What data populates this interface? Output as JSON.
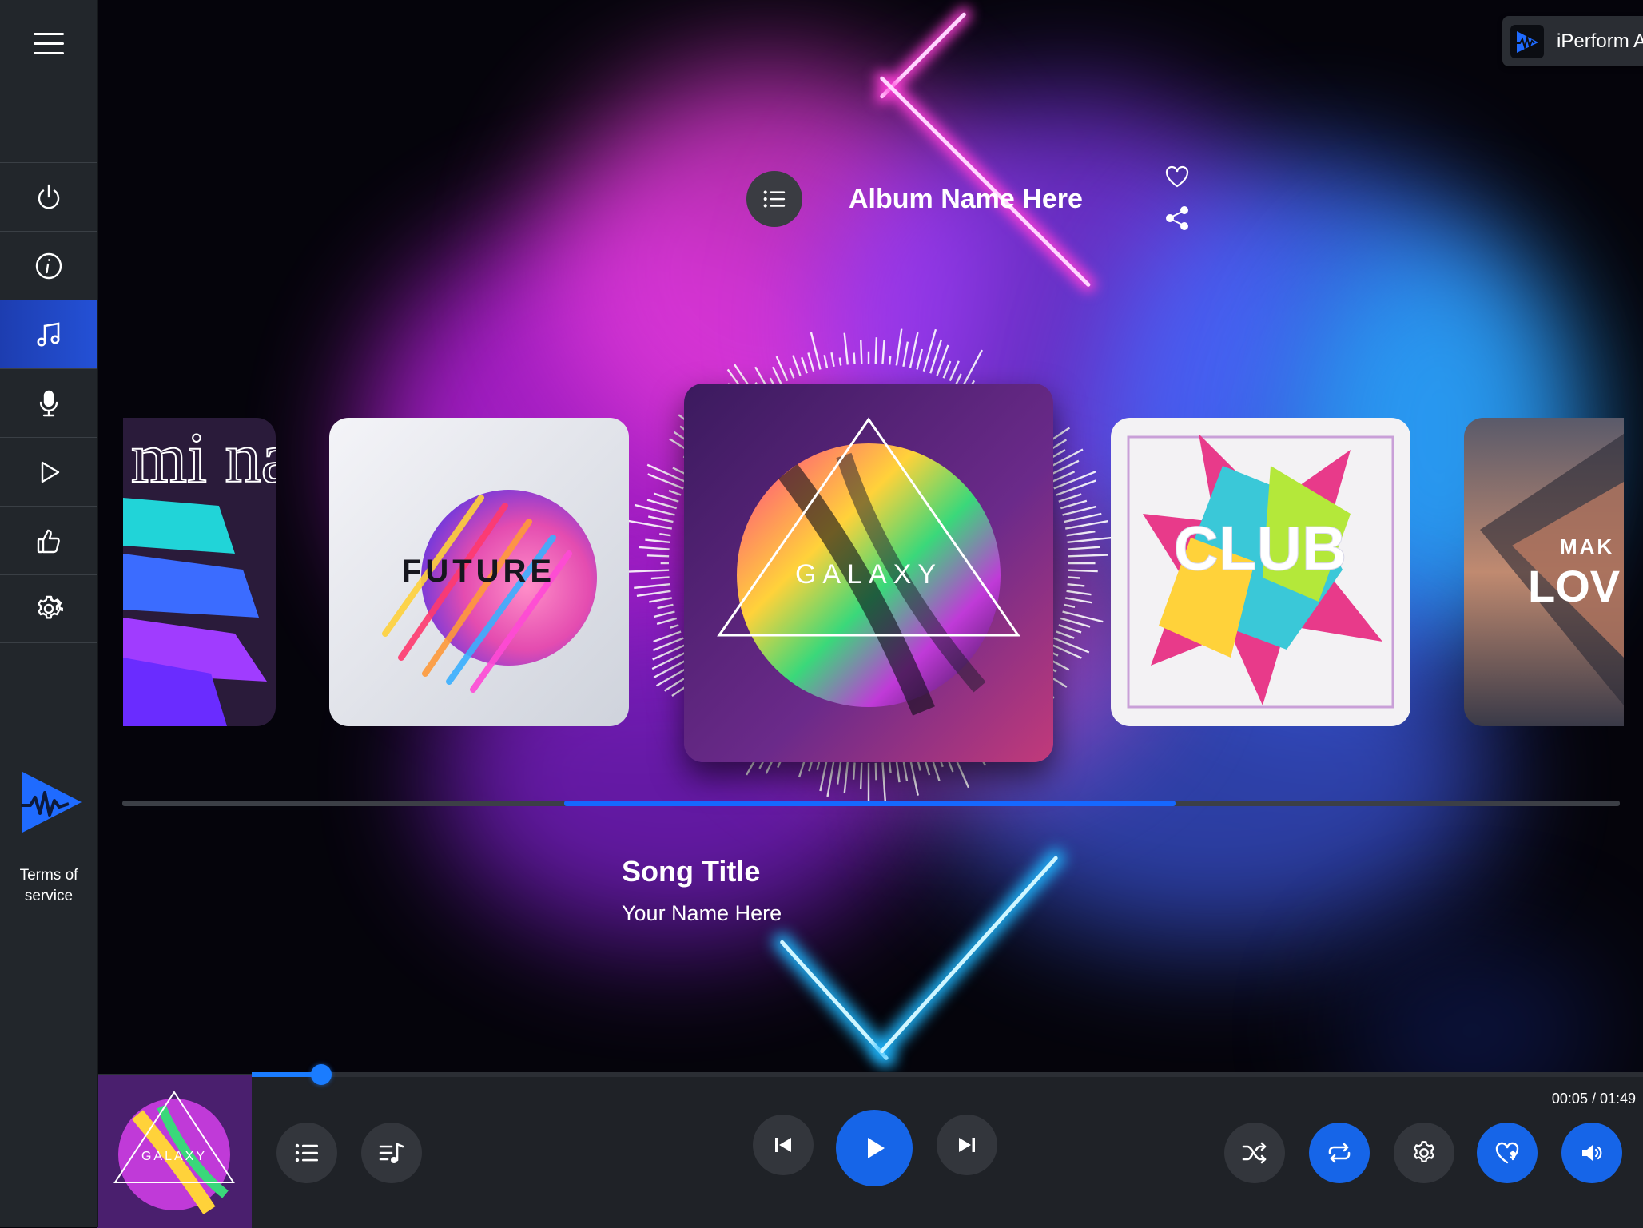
{
  "app": {
    "switcher_name": "iPerform App",
    "accent": "#1665e8",
    "sidebar_bg": "#22262b"
  },
  "sidebar": {
    "items": [
      {
        "id": "power",
        "icon": "power-icon",
        "active": false
      },
      {
        "id": "info",
        "icon": "info-icon",
        "active": false
      },
      {
        "id": "music",
        "icon": "music-note-icon",
        "active": true
      },
      {
        "id": "mic",
        "icon": "microphone-icon",
        "active": false
      },
      {
        "id": "play",
        "icon": "play-outline-icon",
        "active": false
      },
      {
        "id": "like",
        "icon": "thumbs-up-icon",
        "active": false
      },
      {
        "id": "settings",
        "icon": "gear-icon",
        "active": false
      }
    ],
    "terms_label_line1": "Terms of",
    "terms_label_line2": "service"
  },
  "album": {
    "title": "Album Name Here",
    "cards": [
      {
        "id": "left-edge",
        "text": "mi nal"
      },
      {
        "id": "future",
        "text": "FUTURE"
      },
      {
        "id": "galaxy",
        "text": "GALAXY"
      },
      {
        "id": "club",
        "text": "CLUB"
      },
      {
        "id": "love",
        "text_line1": "MAK",
        "text_line2": "LOV"
      }
    ],
    "carousel_position": 0.35
  },
  "song": {
    "title": "Song Title",
    "artist": "Your Name Here"
  },
  "player": {
    "art_label": "GALAXY",
    "time": "00:05 / 01:49",
    "progress": 0.05,
    "buttons": [
      {
        "id": "playlist",
        "icon": "list-icon"
      },
      {
        "id": "queue",
        "icon": "music-queue-icon"
      },
      {
        "id": "previous",
        "icon": "skip-previous-icon"
      },
      {
        "id": "play",
        "icon": "play-icon"
      },
      {
        "id": "next",
        "icon": "skip-next-icon"
      },
      {
        "id": "shuffle",
        "icon": "shuffle-icon"
      },
      {
        "id": "repeat",
        "icon": "repeat-icon"
      },
      {
        "id": "settings",
        "icon": "gear-icon"
      },
      {
        "id": "tip",
        "icon": "heart-dollar-icon"
      },
      {
        "id": "volume",
        "icon": "volume-icon"
      }
    ]
  }
}
